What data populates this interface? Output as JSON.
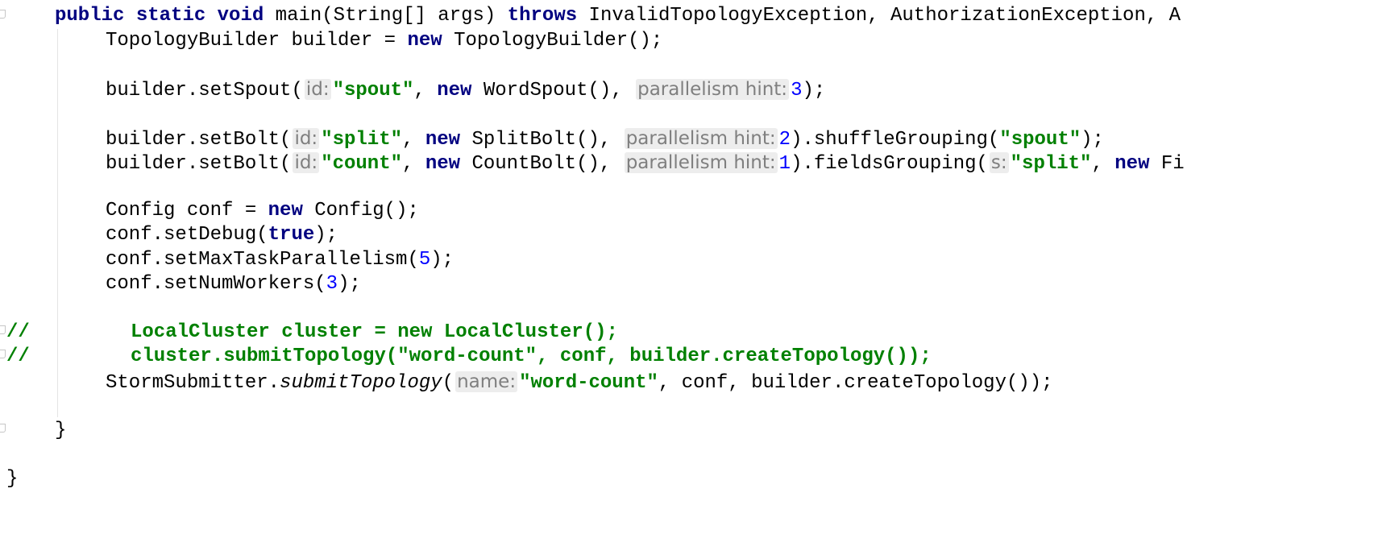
{
  "editor": {
    "lines": {
      "main_sig": {
        "kw_public": "public",
        "kw_static": "static",
        "kw_void": "void",
        "sig_text": " main(String[] args) ",
        "kw_throws": "throws",
        "exceptions": " InvalidTopologyException, AuthorizationException, A"
      },
      "builder_decl": {
        "left": "TopologyBuilder builder = ",
        "kw_new": "new",
        "right": " TopologyBuilder();"
      },
      "set_spout": {
        "call": "builder.setSpout(",
        "hint_id": "id:",
        "id_value": "\"spout\"",
        "comma": ", ",
        "kw_new": "new",
        "ctor": " WordSpout(), ",
        "hint_parallelism": "parallelism hint:",
        "parallelism": "3",
        "end": ");"
      },
      "set_bolt_split": {
        "call": "builder.setBolt(",
        "hint_id": "id:",
        "id_value": "\"split\"",
        "comma": ", ",
        "kw_new": "new",
        "ctor": " SplitBolt(), ",
        "hint_parallelism": "parallelism hint:",
        "parallelism": "2",
        "grouping": ").shuffleGrouping(",
        "grouping_arg": "\"spout\"",
        "end": ");"
      },
      "set_bolt_count": {
        "call": "builder.setBolt(",
        "hint_id": "id:",
        "id_value": "\"count\"",
        "comma": ", ",
        "kw_new": "new",
        "ctor": " CountBolt(), ",
        "hint_parallelism": "parallelism hint:",
        "parallelism": "1",
        "grouping": ").fieldsGrouping(",
        "hint_s": "s:",
        "grouping_arg": "\"split\"",
        "comma2": ", ",
        "kw_new2": "new",
        "tail": " Fi"
      },
      "config_decl": {
        "left": "Config conf = ",
        "kw_new": "new",
        "right": " Config();"
      },
      "set_debug": {
        "call": "conf.setDebug(",
        "kw_true": "true",
        "end": ");"
      },
      "set_max_task": {
        "call": "conf.setMaxTaskParallelism(",
        "value": "5",
        "end": ");"
      },
      "set_num_workers": {
        "call": "conf.setNumWorkers(",
        "value": "3",
        "end": ");"
      },
      "comment_local_cluster": {
        "prefix": "//",
        "text": "LocalCluster cluster = new LocalCluster();"
      },
      "comment_submit": {
        "prefix": "//",
        "text": "cluster.submitTopology(\"word-count\", conf, builder.createTopology());"
      },
      "storm_submit": {
        "cls": "StormSubmitter.",
        "method": "submitTopology",
        "open": "(",
        "hint_name": "name:",
        "name_value": "\"word-count\"",
        "end": ", conf, builder.createTopology());"
      },
      "method_close": "}",
      "class_close": "}"
    }
  }
}
